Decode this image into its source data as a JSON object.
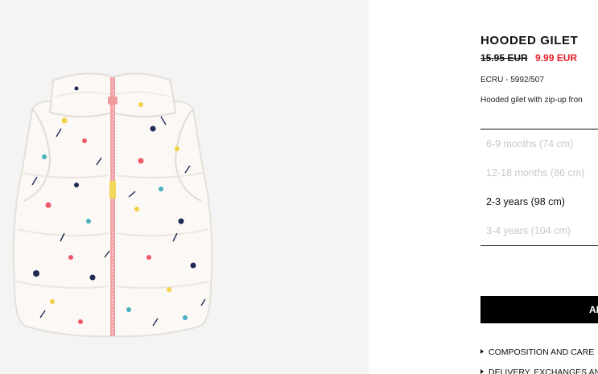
{
  "product": {
    "name": "HOODED GILET",
    "price_original": "15.95 EUR",
    "price_sale": "9.99 EUR",
    "color_ref": "ECRU - 5992/507",
    "description": "Hooded gilet with zip-up fron",
    "image_icon": "padded-gilet-image"
  },
  "sizes": [
    {
      "label": "6-9 months (74 cm)",
      "available": false
    },
    {
      "label": "12-18 months (86 cm)",
      "available": false
    },
    {
      "label": "2-3 years (98 cm)",
      "available": true
    },
    {
      "label": "3-4 years (104 cm)",
      "available": false
    }
  ],
  "add_button": {
    "label": "ADD TO BASKET"
  },
  "accordion": {
    "composition": "COMPOSITION AND CARE",
    "delivery": "DELIVERY, EXCHANGES AND RETURNS"
  },
  "colors": {
    "sale_price": "#e8212b",
    "button_bg": "#000000",
    "disabled_size": "#c8c8c8",
    "image_bg": "#f4f4f4"
  }
}
